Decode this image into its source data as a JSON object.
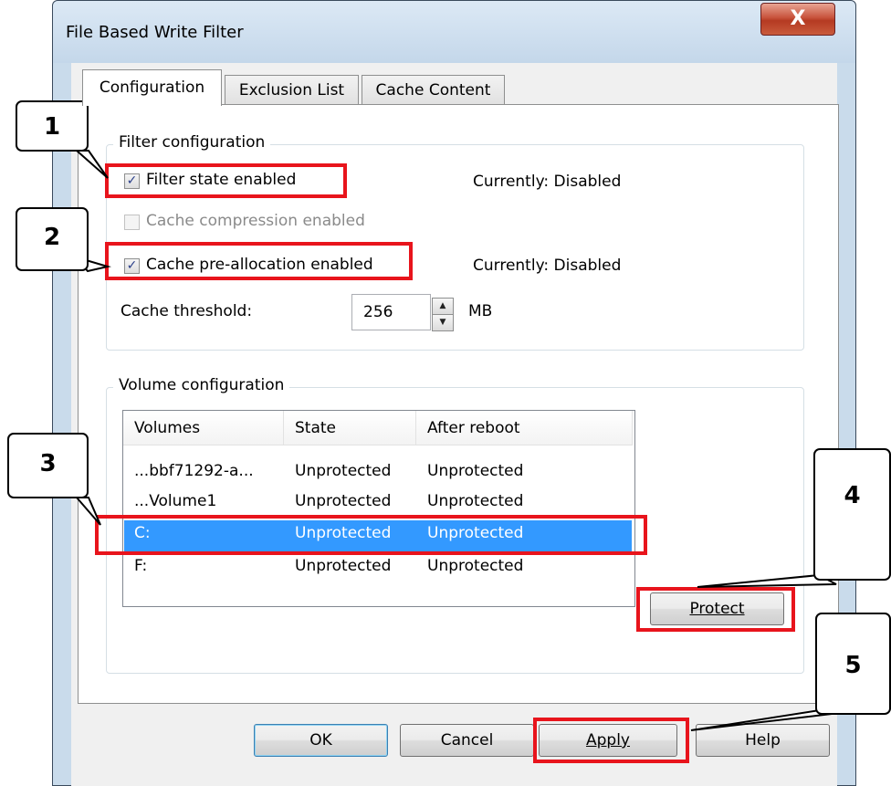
{
  "window": {
    "title": "File Based Write Filter",
    "close_glyph": "X"
  },
  "tabs": [
    {
      "label": "Configuration",
      "active": true
    },
    {
      "label": "Exclusion List",
      "active": false
    },
    {
      "label": "Cache Content",
      "active": false
    }
  ],
  "filter_config": {
    "group_label": "Filter configuration",
    "filter_state": {
      "label": "Filter state enabled",
      "checked": true,
      "status": "Currently: Disabled"
    },
    "cache_compression": {
      "label": "Cache compression enabled",
      "checked": false,
      "enabled": false
    },
    "cache_prealloc": {
      "label": "Cache pre-allocation enabled",
      "checked": true,
      "status": "Currently: Disabled"
    },
    "cache_threshold": {
      "label": "Cache threshold:",
      "value": "256",
      "unit": "MB"
    }
  },
  "volume_config": {
    "group_label": "Volume configuration",
    "columns": [
      "Volumes",
      "State",
      "After reboot"
    ],
    "rows": [
      [
        "...bbf71292-a...",
        "Unprotected",
        "Unprotected"
      ],
      [
        "...Volume1",
        "Unprotected",
        "Unprotected"
      ],
      [
        "C:",
        "Unprotected",
        "Unprotected"
      ],
      [
        "F:",
        "Unprotected",
        "Unprotected"
      ]
    ],
    "selected_row": 2,
    "protect_button": "Protect"
  },
  "buttons": {
    "ok": "OK",
    "cancel": "Cancel",
    "apply": "Apply",
    "help": "Help"
  },
  "callouts": [
    "1",
    "2",
    "3",
    "4",
    "5"
  ],
  "colors": {
    "highlight_red": "#e8141c",
    "selection_blue": "#3399ff"
  },
  "icons": {
    "checkmark": "✓",
    "spin_up": "▲",
    "spin_down": "▼"
  }
}
